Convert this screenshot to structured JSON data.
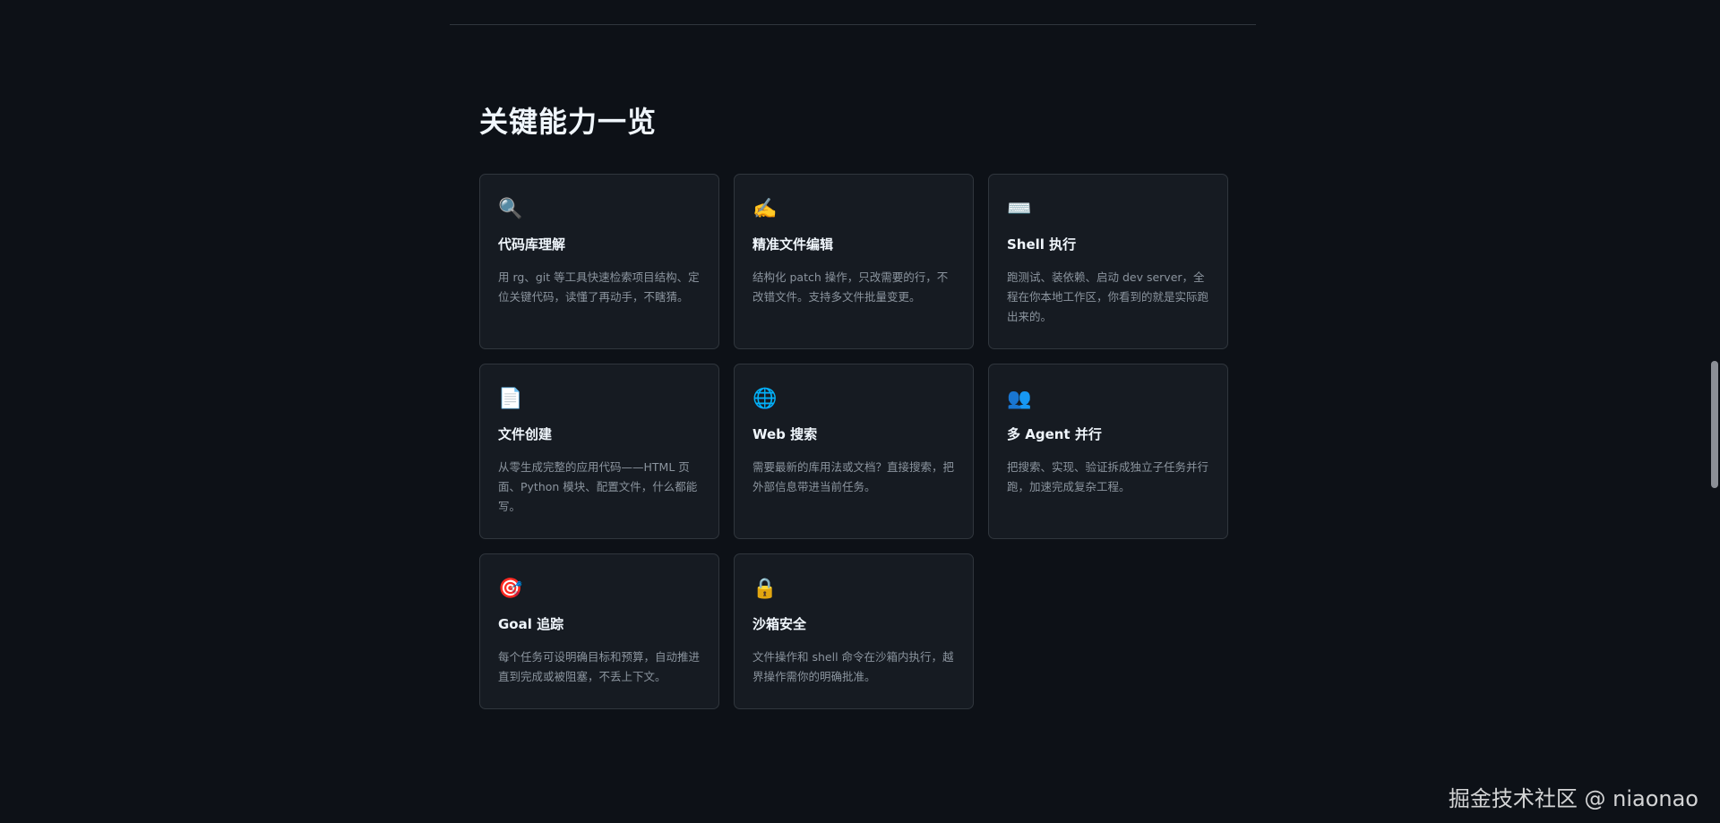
{
  "section": {
    "title": "关键能力一览"
  },
  "cards": [
    {
      "icon": "magnifier-icon",
      "glyph": "🔍",
      "title": "代码库理解",
      "desc": "用 rg、git 等工具快速检索项目结构、定位关键代码，读懂了再动手，不瞎猜。"
    },
    {
      "icon": "writing-hand-icon",
      "glyph": "✍️",
      "title": "精准文件编辑",
      "desc": "结构化 patch 操作，只改需要的行，不改错文件。支持多文件批量变更。"
    },
    {
      "icon": "keyboard-icon",
      "glyph": "⌨️",
      "title": "Shell 执行",
      "desc": "跑测试、装依赖、启动 dev server，全程在你本地工作区，你看到的就是实际跑出来的。"
    },
    {
      "icon": "document-icon",
      "glyph": "📄",
      "title": "文件创建",
      "desc": "从零生成完整的应用代码——HTML 页面、Python 模块、配置文件，什么都能写。"
    },
    {
      "icon": "globe-icon",
      "glyph": "🌐",
      "title": "Web 搜索",
      "desc": "需要最新的库用法或文档？直接搜索，把外部信息带进当前任务。"
    },
    {
      "icon": "people-icon",
      "glyph": "👥",
      "title": "多 Agent 并行",
      "desc": "把搜索、实现、验证拆成独立子任务并行跑，加速完成复杂工程。"
    },
    {
      "icon": "target-icon",
      "glyph": "🎯",
      "title": "Goal 追踪",
      "desc": "每个任务可设明确目标和预算，自动推进直到完成或被阻塞，不丢上下文。"
    },
    {
      "icon": "lock-icon",
      "glyph": "🔒",
      "title": "沙箱安全",
      "desc": "文件操作和 shell 命令在沙箱内执行，越界操作需你的明确批准。"
    }
  ],
  "watermark": "掘金技术社区 @ niaonao"
}
